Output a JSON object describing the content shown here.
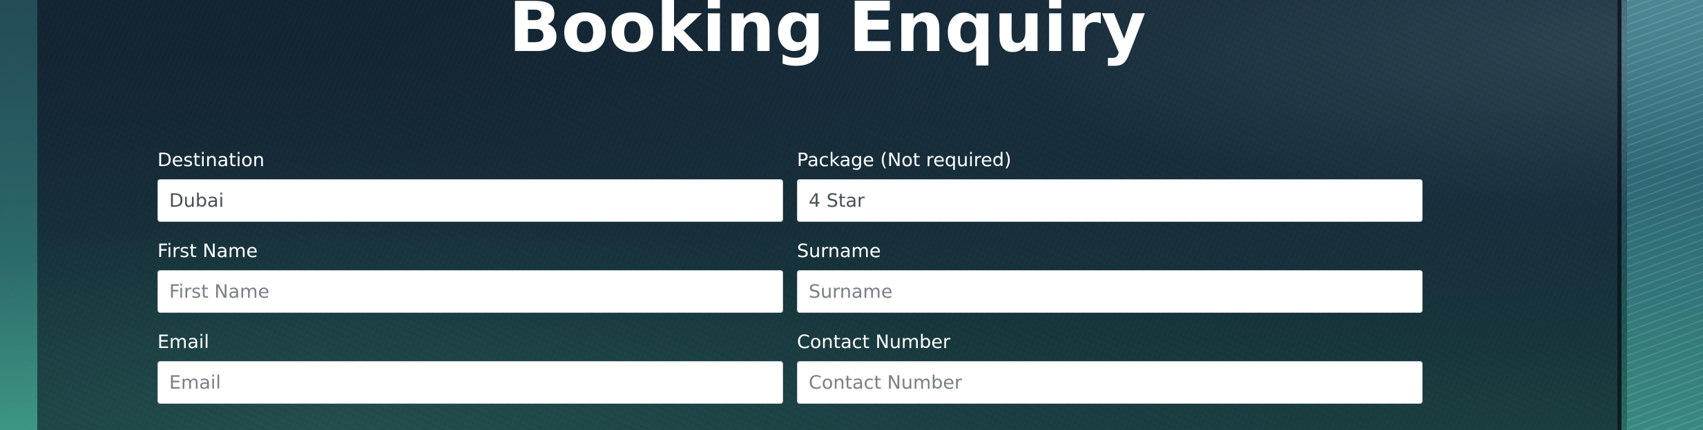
{
  "page": {
    "title": "Booking Enquiry"
  },
  "form": {
    "destination": {
      "label": "Destination",
      "value": "Dubai"
    },
    "package": {
      "label": "Package (Not required)",
      "value": "4 Star"
    },
    "first_name": {
      "label": "First Name",
      "placeholder": "First Name"
    },
    "surname": {
      "label": "Surname",
      "placeholder": "Surname"
    },
    "email": {
      "label": "Email",
      "placeholder": "Email"
    },
    "contact_number": {
      "label": "Contact Number",
      "placeholder": "Contact Number"
    }
  },
  "colors": {
    "title_text": "#ffffff",
    "label_text": "#ffffff",
    "input_background": "#ffffff",
    "input_border": "#c7ccd1",
    "panel_overlay": "#0e1a26"
  }
}
